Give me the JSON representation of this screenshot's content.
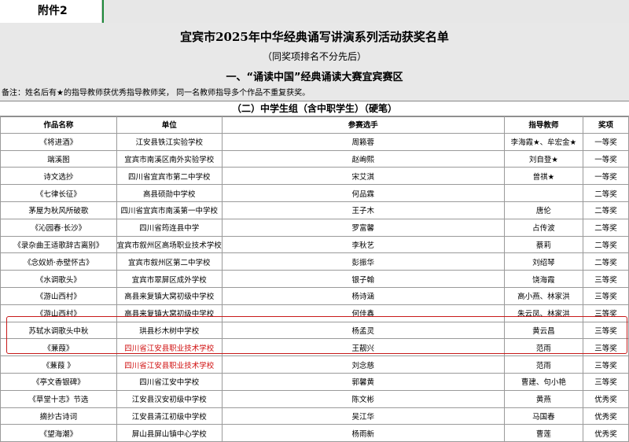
{
  "sheet_tab": "附件2",
  "title": "宜宾市2025年中华经典诵写讲演系列活动获奖名单",
  "subtitle": "（同奖项排名不分先后）",
  "section": "一、“诵读中国”经典诵读大赛宜宾赛区",
  "note": "备注：姓名后有★的指导教师获优秀指导教师奖， 同一名教师指导多个作品不重复获奖。",
  "group": "（二）中学生组（含中职学生）（硬笔）",
  "headers": [
    "作品名称",
    "单位",
    "参赛选手",
    "指导教师",
    "奖项"
  ],
  "rows": [
    [
      "《将进酒》",
      "江安县铁江实验学校",
      "周籁蓉",
      "李海霞★、牟宏金★",
      "一等奖"
    ],
    [
      "端溪图",
      "宜宾市南溪区南外实验学校",
      "赵峋熙",
      "刘自登★",
      "一等奖"
    ],
    [
      "诗文选抄",
      "四川省宜宾市第二中学校",
      "宋艾淇",
      "曾祺★",
      "一等奖"
    ],
    [
      "《七律长征》",
      "高县硕勋中学校",
      "何品霖",
      "",
      "二等奖"
    ],
    [
      "茅屋为秋风所破歌",
      "四川省宜宾市南溪第一中学校",
      "王子木",
      "唐伦",
      "二等奖"
    ],
    [
      "《沁园春·长沙》",
      "四川省筠连县中学",
      "罗富馨",
      "占传波",
      "二等奖"
    ],
    [
      "《录杂曲王适歌辞古离别》",
      "宜宾市叙州区高场职业技术学校",
      "李秋艺",
      "蔡莉",
      "二等奖"
    ],
    [
      "《念奴娇·赤壁怀古》",
      "宜宾市叙州区第二中学校",
      "彭振华",
      "刘绍琴",
      "二等奖"
    ],
    [
      "《水调歌头》",
      "宜宾市翠屏区成外学校",
      "银子翰",
      "饶海霞",
      "三等奖"
    ],
    [
      "《游山西村》",
      "高县来复镇大窝初级中学校",
      "杨诗涵",
      "高小燕、林家洪",
      "三等奖"
    ],
    [
      "《游山西村》",
      "高县来复镇大窝初级中学校",
      "何佳鑫",
      "朱云凤、林家洪",
      "三等奖"
    ],
    [
      "苏轼水调歌头中秋",
      "珙县杉木树中学校",
      "杨孟灵",
      "黄云昌",
      "三等奖"
    ],
    [
      "《蒹葭》",
      "四川省江安县职业技术学校",
      "王靓兴",
      "范雨",
      "三等奖"
    ],
    [
      "《蒹葭 》",
      "四川省江安县职业技术学校",
      "刘念慈",
      "范雨",
      "三等奖"
    ],
    [
      "《亭文香银碑》",
      "四川省江安中学校",
      "郭馨黄",
      "曹建、句小艳",
      "三等奖"
    ],
    [
      "《草堂十志》节选",
      "江安县汉安初级中学校",
      "陈文彬",
      "黄燕",
      "优秀奖"
    ],
    [
      "摘抄古诗词",
      "江安县清江初级中学校",
      "吴江华",
      "马国春",
      "优秀奖"
    ],
    [
      "《望海潮》",
      "屏山县屏山镇中心学校",
      "杨雨新",
      "曹莲",
      "优秀奖"
    ]
  ],
  "colors": {
    "highlight_text": "#d01010",
    "highlight_box": "#c81a1a",
    "tab_accent": "#1f8a3b"
  }
}
